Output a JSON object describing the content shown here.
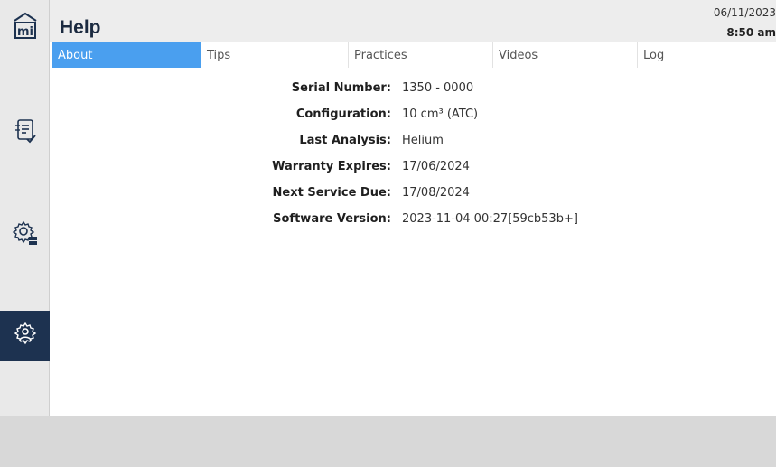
{
  "header": {
    "title": "Help",
    "date": "06/11/2023",
    "time": "8:50 am"
  },
  "tabs": [
    {
      "label": "About",
      "active": true
    },
    {
      "label": "Tips",
      "active": false
    },
    {
      "label": "Practices",
      "active": false
    },
    {
      "label": "Videos",
      "active": false
    },
    {
      "label": "Log",
      "active": false
    }
  ],
  "sidebar": {
    "logo_icon": "building-mi-logo-icon",
    "items": [
      {
        "icon": "checklist-icon",
        "active": false
      },
      {
        "icon": "gear-grid-icon",
        "active": false
      },
      {
        "icon": "gear-user-icon",
        "active": true
      }
    ]
  },
  "about": {
    "rows": [
      {
        "label": "Serial Number:",
        "value": "1350 - 0000"
      },
      {
        "label": "Configuration:",
        "value": "10 cm³ (ATC)"
      },
      {
        "label": "Last Analysis:",
        "value": "Helium"
      },
      {
        "label": "Warranty Expires:",
        "value": "17/06/2024"
      },
      {
        "label": "Next Service Due:",
        "value": "17/08/2024"
      },
      {
        "label": "Software Version:",
        "value": "2023-11-04 00:27[59cb53b+]"
      }
    ]
  },
  "colors": {
    "accent_tab": "#4a9fef",
    "active_nav": "#1d3250",
    "sidebar_bg": "#e9e9e9",
    "footer_bg": "#d8d8d8"
  }
}
